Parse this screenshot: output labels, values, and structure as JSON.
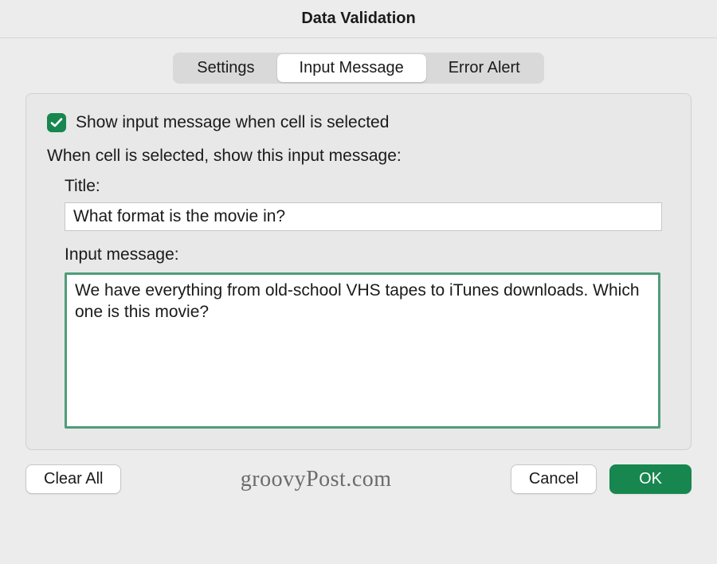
{
  "title": "Data Validation",
  "tabs": {
    "settings": "Settings",
    "input_message": "Input Message",
    "error_alert": "Error Alert",
    "active": "input_message"
  },
  "checkbox": {
    "checked": true,
    "label": "Show input message when cell is selected"
  },
  "section_prompt": "When cell is selected, show this input message:",
  "title_field": {
    "label": "Title:",
    "value": "What format is the movie in?"
  },
  "message_field": {
    "label": "Input message:",
    "value": "We have everything from old-school VHS tapes to iTunes downloads. Which one is this movie?"
  },
  "buttons": {
    "clear_all": "Clear All",
    "cancel": "Cancel",
    "ok": "OK"
  },
  "watermark": "groovyPost.com",
  "colors": {
    "accent": "#17864f",
    "focus_border": "#4f9d78"
  }
}
